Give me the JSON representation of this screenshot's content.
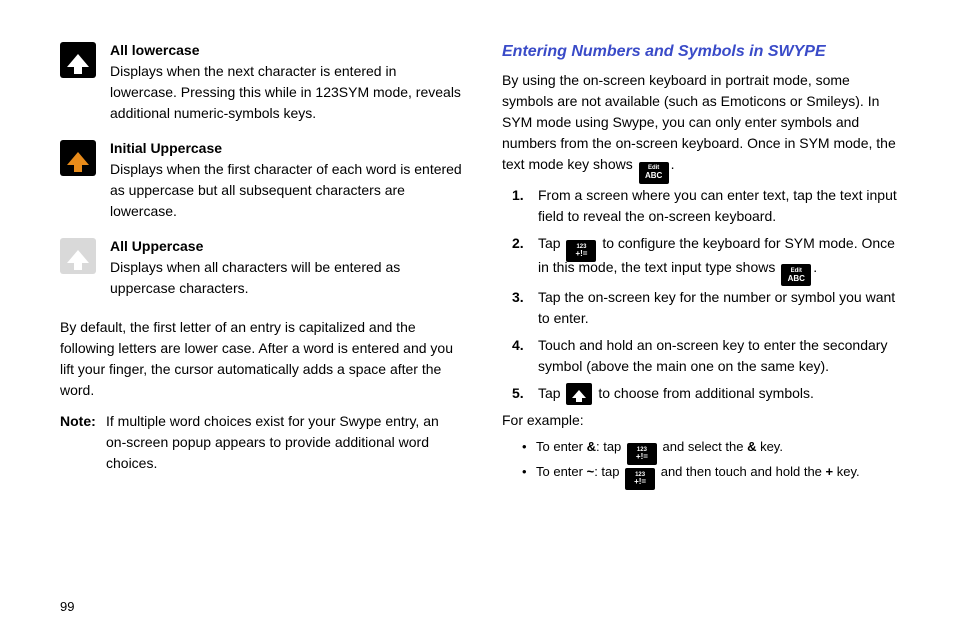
{
  "page_number": "99",
  "left": {
    "items": [
      {
        "title": "All lowercase",
        "desc": "Displays when the next character is entered in lowercase. Pressing this while in 123SYM mode, reveals additional numeric-symbols keys.",
        "icon": "shift-black-white"
      },
      {
        "title": "Initial Uppercase",
        "desc": "Displays when the first character of each word is entered as uppercase but all subsequent characters are lowercase.",
        "icon": "shift-black-orange"
      },
      {
        "title": "All Uppercase",
        "desc": "Displays when all characters will be entered as uppercase characters.",
        "icon": "shift-grey-white"
      }
    ],
    "default_para": "By default, the first letter of an entry is capitalized and the following letters are lower case. After a word is entered and you lift your finger, the cursor automatically adds a space after the word.",
    "note_label": "Note:",
    "note_text": "If multiple word choices exist for your Swype entry, an on-screen popup appears to provide additional word choices."
  },
  "right": {
    "heading": "Entering Numbers and Symbols in SWYPE",
    "intro_before": "By using the on-screen keyboard in portrait mode, some symbols are not available (such as Emoticons or Smileys). In SYM mode using Swype, you can only enter symbols and numbers from the on-screen keyboard. Once in SYM mode, the text mode key shows ",
    "intro_after": ".",
    "steps": {
      "s1": "From a screen where you can enter text, tap the text input field to reveal the on-screen keyboard.",
      "s2_a": "Tap ",
      "s2_b": " to configure the keyboard for SYM mode. Once in this mode, the text input type shows ",
      "s2_c": ".",
      "s3": "Tap the on-screen key for the number or symbol you want to enter.",
      "s4": "Touch and hold an on-screen key to enter the secondary symbol (above the main one on the same key).",
      "s5_a": "Tap ",
      "s5_b": " to choose from additional symbols."
    },
    "example_label": "For example:",
    "ex1_a": "To enter ",
    "ex1_sym": "&",
    "ex1_b": ": tap ",
    "ex1_c": " and select the ",
    "ex1_d": " key.",
    "ex2_a": "To enter ",
    "ex2_sym": "~",
    "ex2_b": ": tap ",
    "ex2_c": " and then touch and hold the ",
    "ex2_plus": "+",
    "ex2_d": " key."
  },
  "icon_labels": {
    "edit_abc_top": "Edit",
    "edit_abc_bot": "ABC",
    "sym_top": "123",
    "sym_bot": "+!="
  }
}
